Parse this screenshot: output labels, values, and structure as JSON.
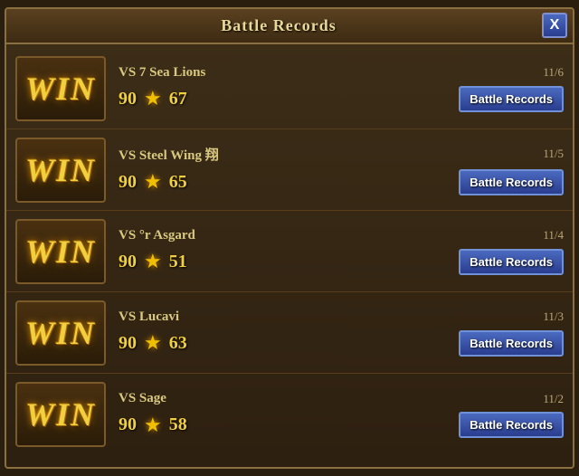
{
  "modal": {
    "title": "Battle Records",
    "close_label": "X"
  },
  "records": [
    {
      "result": "WIN",
      "opponent": "VS  7 Sea Lions",
      "date": "11/6",
      "score_my": "90",
      "score_opp": "67",
      "button_label": "Battle Records"
    },
    {
      "result": "WIN",
      "opponent": "VS  Steel Wing 翔",
      "date": "11/5",
      "score_my": "90",
      "score_opp": "65",
      "button_label": "Battle Records"
    },
    {
      "result": "WIN",
      "opponent": "VS  °r Asgard",
      "date": "11/4",
      "score_my": "90",
      "score_opp": "51",
      "button_label": "Battle Records"
    },
    {
      "result": "WIN",
      "opponent": "VS  Lucavi",
      "date": "11/3",
      "score_my": "90",
      "score_opp": "63",
      "button_label": "Battle Records"
    },
    {
      "result": "WIN",
      "opponent": "VS  Sage",
      "date": "11/2",
      "score_my": "90",
      "score_opp": "58",
      "button_label": "Battle Records"
    }
  ]
}
